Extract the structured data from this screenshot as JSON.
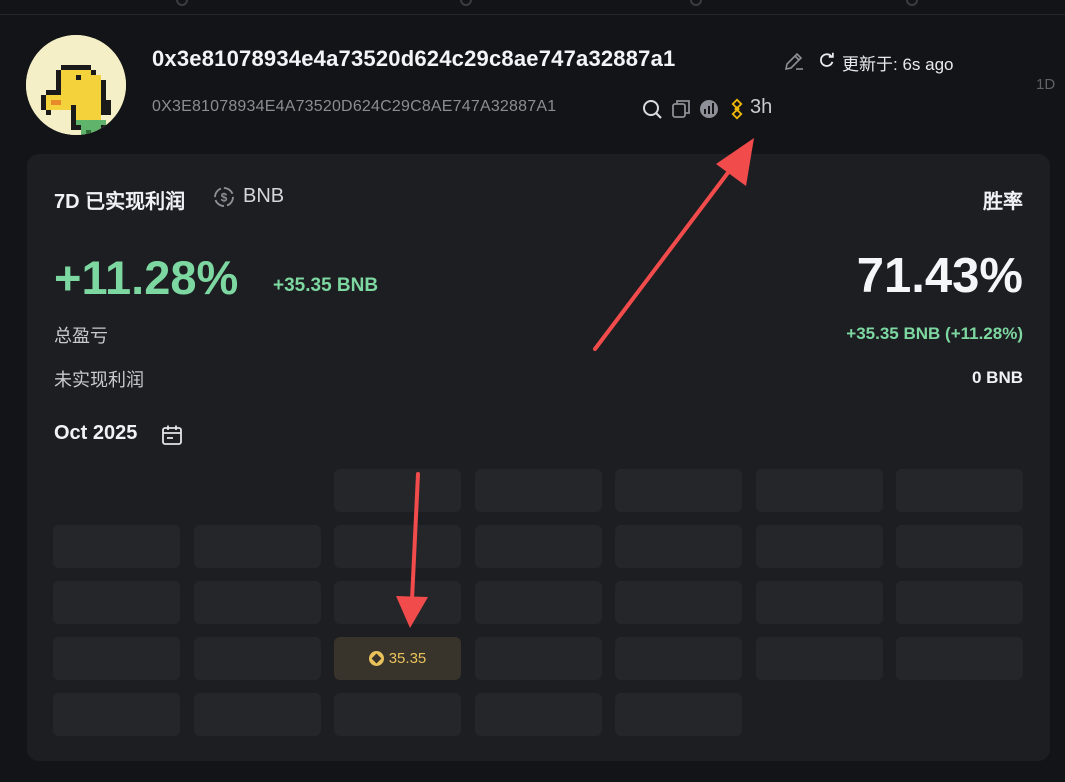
{
  "header": {
    "address": "0x3e81078934e4a73520d624c29c8ae747a32887a1",
    "address_upper": "0X3E81078934E4A73520D624C29C8AE747A32887A1",
    "updated": "更新于: 6s ago",
    "timeframe": "1D",
    "age": "3h",
    "icons": [
      "edit-icon",
      "refresh-icon",
      "search-icon",
      "copy-icon",
      "explorer-icon",
      "bnb-chain-icon"
    ]
  },
  "summary": {
    "title": "7D 已实现利润",
    "currency": "BNB",
    "pnl_percent": "+11.28%",
    "pnl_amount": "+35.35 BNB",
    "winrate_title": "胜率",
    "winrate_value": "71.43%",
    "total_pnl_label": "总盈亏",
    "total_pnl_value": "+35.35 BNB (+11.28%)",
    "unrealized_label": "未实现利润",
    "unrealized_value": "0 BNB"
  },
  "calendar": {
    "month": "Oct 2025",
    "active_day_value": "35.35"
  },
  "colors": {
    "background": "#131417",
    "card": "#1d1e22",
    "cell": "#25262a",
    "positive": "#7dd7a0",
    "bnb_gold": "#e9c25b",
    "annotation_arrow": "#f24b4b"
  }
}
